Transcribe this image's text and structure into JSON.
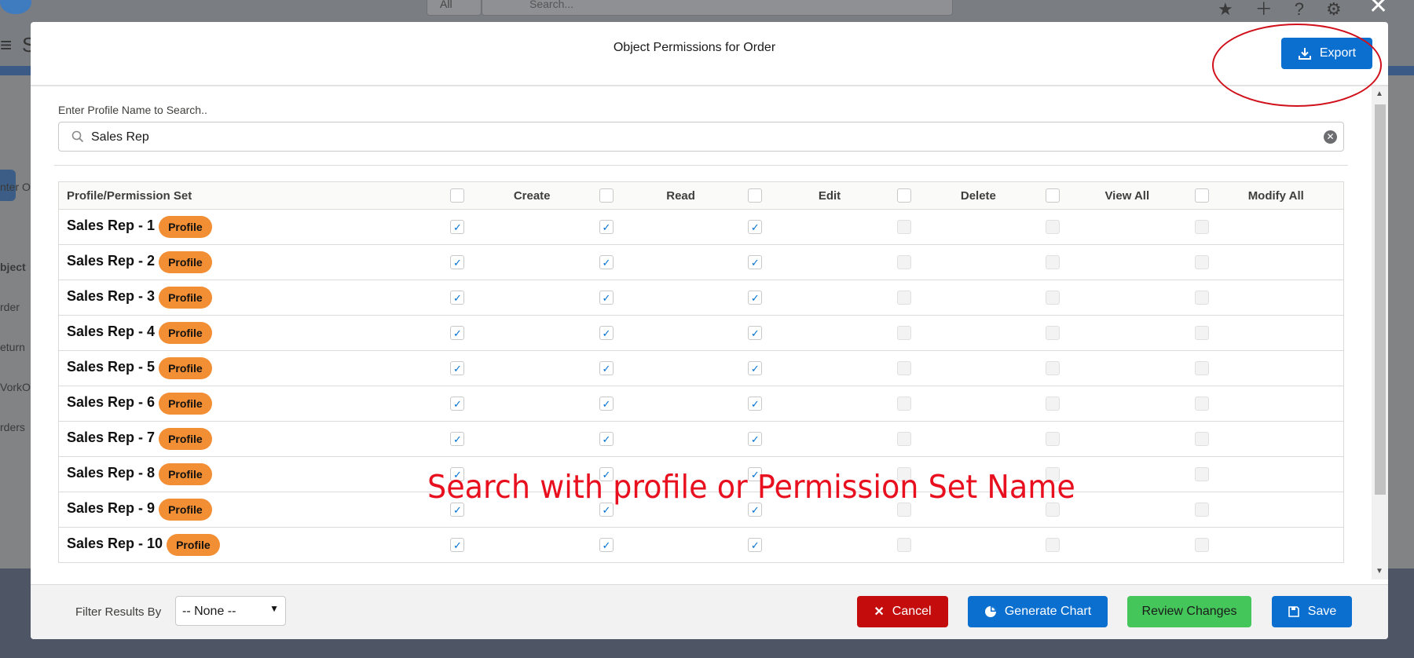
{
  "background": {
    "app_letter": "S",
    "scope_label": "All",
    "search_placeholder": "Search...",
    "side_labels": [
      "nter O",
      "bject",
      "rder",
      "eturn",
      "VorkO",
      "rders"
    ]
  },
  "modal": {
    "title": "Object Permissions for Order",
    "export_label": "Export",
    "search": {
      "label": "Enter Profile Name to Search..",
      "value": "Sales Rep"
    },
    "table": {
      "name_header": "Profile/Permission Set",
      "permission_headers": [
        "Create",
        "Read",
        "Edit",
        "Delete",
        "View All",
        "Modify All"
      ],
      "rows": [
        {
          "name": "Sales Rep - 1",
          "type": "Profile",
          "perms": [
            true,
            true,
            true,
            false,
            false,
            false
          ]
        },
        {
          "name": "Sales Rep - 2",
          "type": "Profile",
          "perms": [
            true,
            true,
            true,
            false,
            false,
            false
          ]
        },
        {
          "name": "Sales Rep - 3",
          "type": "Profile",
          "perms": [
            true,
            true,
            true,
            false,
            false,
            false
          ]
        },
        {
          "name": "Sales Rep - 4",
          "type": "Profile",
          "perms": [
            true,
            true,
            true,
            false,
            false,
            false
          ]
        },
        {
          "name": "Sales Rep - 5",
          "type": "Profile",
          "perms": [
            true,
            true,
            true,
            false,
            false,
            false
          ]
        },
        {
          "name": "Sales Rep - 6",
          "type": "Profile",
          "perms": [
            true,
            true,
            true,
            false,
            false,
            false
          ]
        },
        {
          "name": "Sales Rep - 7",
          "type": "Profile",
          "perms": [
            true,
            true,
            true,
            false,
            false,
            false
          ]
        },
        {
          "name": "Sales Rep - 8",
          "type": "Profile",
          "perms": [
            true,
            true,
            true,
            false,
            false,
            false
          ]
        },
        {
          "name": "Sales Rep - 9",
          "type": "Profile",
          "perms": [
            true,
            true,
            true,
            false,
            false,
            false
          ]
        },
        {
          "name": "Sales Rep - 10",
          "type": "Profile",
          "perms": [
            true,
            true,
            true,
            false,
            false,
            false
          ]
        }
      ]
    },
    "annotation": "Search with profile or Permission Set Name",
    "footer": {
      "filter_label": "Filter Results By",
      "filter_value": "-- None --",
      "cancel_label": "Cancel",
      "chart_label": "Generate Chart",
      "review_label": "Review Changes",
      "save_label": "Save"
    }
  },
  "colors": {
    "brand_blue": "#0b6fd0",
    "cancel_red": "#c40c0c",
    "review_green": "#45c65a",
    "badge_orange": "#f28e33",
    "annotation_red": "#e8101f"
  }
}
